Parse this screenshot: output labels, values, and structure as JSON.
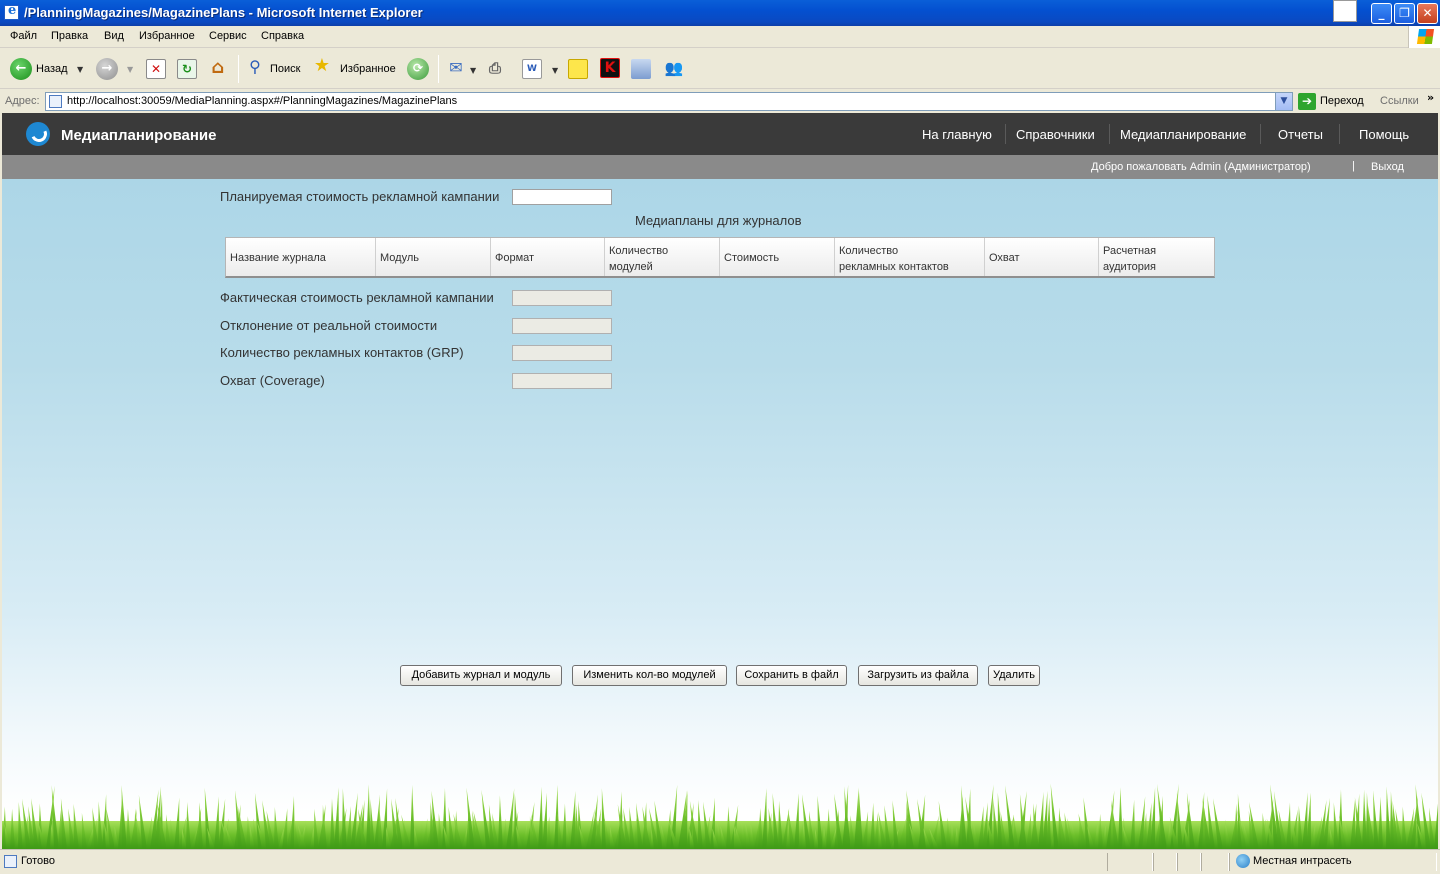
{
  "window": {
    "title": "/PlanningMagazines/MagazinePlans - Microsoft Internet Explorer",
    "min_glyph": "_",
    "max_glyph": "❐",
    "close_glyph": "✕"
  },
  "menu": {
    "items": [
      "Файл",
      "Правка",
      "Вид",
      "Избранное",
      "Сервис",
      "Справка"
    ]
  },
  "toolbar": {
    "back_label": "Назад",
    "search_label": "Поиск",
    "favorites_label": "Избранное"
  },
  "address": {
    "label": "Адрес:",
    "url": "http://localhost:30059/MediaPlanning.aspx#/PlanningMagazines/MagazinePlans",
    "go_label": "Переход",
    "links_label": "Ссылки",
    "links_more": "»"
  },
  "site": {
    "title": "Медиапланирование",
    "nav": [
      "На главную",
      "Справочники",
      "Медиапланирование",
      "Отчеты",
      "Помощь"
    ],
    "welcome": "Добро пожаловать Admin (Администратор)",
    "separator": "|",
    "logout": "Выход"
  },
  "form": {
    "planned_cost_label": "Планируемая стоимость рекламной кампании",
    "planned_cost_value": "",
    "section_title": "Медиапланы для журналов",
    "actual_cost_label": "Фактическая стоимость рекламной кампании",
    "actual_cost_value": "",
    "deviation_label": "Отклонение от реальной стоимости",
    "deviation_value": "",
    "contacts_label": "Количество рекламных контактов (GRP)",
    "contacts_value": "",
    "coverage_label": "Охват (Coverage)",
    "coverage_value": ""
  },
  "grid": {
    "columns": [
      {
        "line1": "Название журнала",
        "line2": ""
      },
      {
        "line1": "Модуль",
        "line2": ""
      },
      {
        "line1": "Формат",
        "line2": ""
      },
      {
        "line1": "Количество",
        "line2": "модулей"
      },
      {
        "line1": "Стоимость",
        "line2": ""
      },
      {
        "line1": "Количество",
        "line2": "рекламных контактов"
      },
      {
        "line1": "Охват",
        "line2": ""
      },
      {
        "line1": "Расчетная",
        "line2": "аудитория"
      }
    ],
    "rows": []
  },
  "actions": {
    "add": "Добавить журнал и модуль",
    "change": "Изменить кол-во модулей",
    "save": "Сохранить в файл",
    "load": "Загрузить из файла",
    "delete": "Удалить"
  },
  "status": {
    "text": "Готово",
    "zone": "Местная интрасеть"
  },
  "colors": {
    "header_bg": "#3a3a3a",
    "welcome_bg": "#8a8a8a",
    "page_sky": "#a8d4e6",
    "grass": "#6cbf2a"
  }
}
